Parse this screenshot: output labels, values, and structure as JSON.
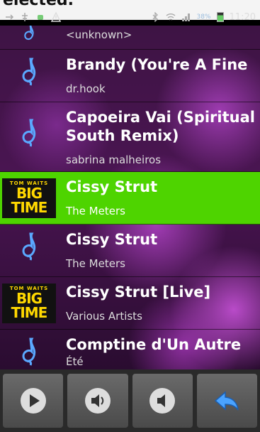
{
  "top_strip": {
    "text": "elected."
  },
  "status_bar": {
    "battery_text": "38%",
    "time": "11:20"
  },
  "list": {
    "items": [
      {
        "title": "",
        "subtitle": "<unknown>",
        "thumb": "music-note",
        "selected": false
      },
      {
        "title": "Brandy (You're A Fine",
        "subtitle": "dr.hook",
        "thumb": "music-note",
        "selected": false
      },
      {
        "title": "Capoeira Vai (Spiritual\nSouth Remix)",
        "subtitle": "sabrina malheiros",
        "thumb": "music-note",
        "selected": false
      },
      {
        "title": "Cissy Strut",
        "subtitle": "The Meters",
        "thumb": "album-art",
        "selected": true
      },
      {
        "title": "Cissy Strut",
        "subtitle": "The Meters",
        "thumb": "music-note",
        "selected": false
      },
      {
        "title": "Cissy Strut [Live]",
        "subtitle": "Various Artists",
        "thumb": "album-art",
        "selected": false
      },
      {
        "title": "Comptine d'Un Autre",
        "subtitle": "Été",
        "thumb": "music-note",
        "selected": false
      }
    ]
  },
  "album_art": {
    "line1": "TOM WAITS",
    "line2": "BIG",
    "line3": "TIME"
  },
  "controls": {
    "buttons": [
      {
        "name": "play-button",
        "icon": "play-icon"
      },
      {
        "name": "volume-up-button",
        "icon": "volume-up-icon"
      },
      {
        "name": "volume-down-button",
        "icon": "volume-down-icon"
      },
      {
        "name": "back-button",
        "icon": "back-arrow-icon"
      }
    ]
  },
  "colors": {
    "selected_row": "#4ed400",
    "list_background": "#4a1552",
    "controls_background": "#2a2a2a"
  }
}
